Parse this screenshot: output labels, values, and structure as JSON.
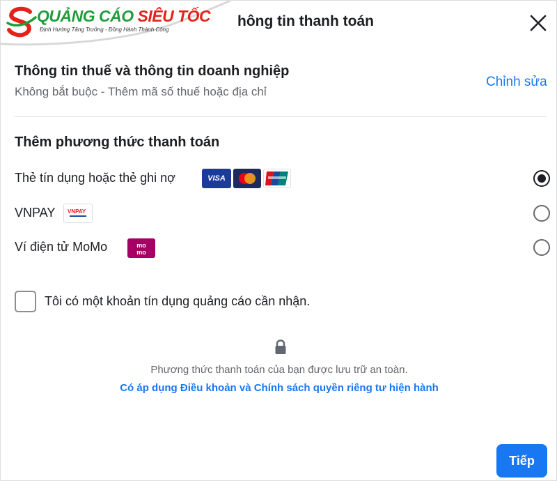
{
  "header": {
    "title": "hông tin thanh toán"
  },
  "logo": {
    "brand_green": "QUẢNG CÁO",
    "brand_red": "SIÊU TỐC",
    "slogan": "Định Hướng Tăng Trưởng - Đồng Hành Thành Công"
  },
  "tax": {
    "title": "Thông tin thuế và thông tin doanh nghiệp",
    "subtitle": "Không bắt buộc - Thêm mã số thuế hoặc địa chỉ",
    "edit_label": "Chỉnh sửa"
  },
  "payment": {
    "title": "Thêm phương thức thanh toán",
    "methods": [
      {
        "label": "Thẻ tín dụng hoặc thẻ ghi nợ",
        "selected": true,
        "logos": [
          "visa-icon",
          "mastercard-icon",
          "unionpay-icon"
        ]
      },
      {
        "label": "VNPAY",
        "selected": false,
        "logos": [
          "vnpay-icon"
        ]
      },
      {
        "label": "Ví điện tử MoMo",
        "selected": false,
        "logos": [
          "momo-icon"
        ]
      }
    ],
    "visa_text": "VISA",
    "vnpay_text": "VNPAY",
    "momo_text": "mo mo"
  },
  "credit": {
    "label": "Tôi có một khoản tín dụng quảng cáo cần nhận.",
    "checked": false
  },
  "footer": {
    "secure_text": "Phương thức thanh toán của bạn được lưu trữ an toàn.",
    "terms_link": "Có áp dụng Điều khoản và Chính sách quyền riêng tư hiện hành",
    "next_label": "Tiếp"
  },
  "colors": {
    "accent": "#1877f2",
    "text": "#1c1e21",
    "secondary": "#65676b",
    "momo": "#a50064",
    "visa": "#1a3b9a"
  }
}
